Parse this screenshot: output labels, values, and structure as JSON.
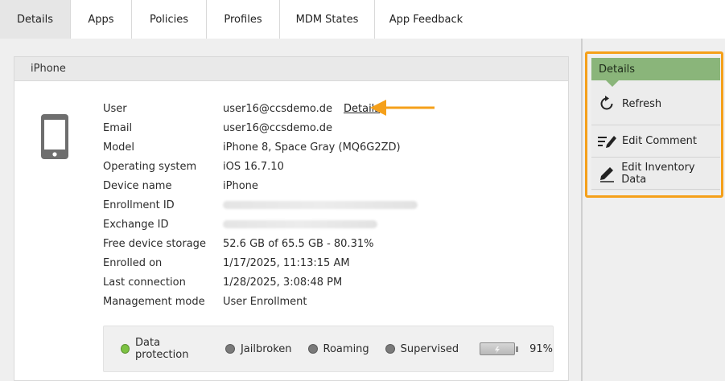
{
  "tabs": [
    {
      "label": "Details",
      "active": true
    },
    {
      "label": "Apps"
    },
    {
      "label": "Policies"
    },
    {
      "label": "Profiles"
    },
    {
      "label": "MDM States"
    },
    {
      "label": "App Feedback"
    }
  ],
  "device_panel": {
    "title": "iPhone",
    "rows": {
      "user": {
        "label": "User",
        "value": "user16@ccsdemo.de",
        "link": "Details"
      },
      "email": {
        "label": "Email",
        "value": "user16@ccsdemo.de"
      },
      "model": {
        "label": "Model",
        "value": "iPhone 8, Space Gray (MQ6G2ZD)"
      },
      "os": {
        "label": "Operating system",
        "value": "iOS 16.7.10"
      },
      "device_name": {
        "label": "Device name",
        "value": "iPhone"
      },
      "enrollment_id": {
        "label": "Enrollment ID",
        "value": ""
      },
      "exchange_id": {
        "label": "Exchange ID",
        "value": ""
      },
      "storage": {
        "label": "Free device storage",
        "value": "52.6 GB of 65.5 GB - 80.31%"
      },
      "enrolled_on": {
        "label": "Enrolled on",
        "value": "1/17/2025, 11:13:15 AM"
      },
      "last_connection": {
        "label": "Last connection",
        "value": "1/28/2025, 3:08:48 PM"
      },
      "management_mode": {
        "label": "Management mode",
        "value": "User Enrollment"
      }
    },
    "status": {
      "data_protection": {
        "label": "Data protection",
        "color": "#7cc242"
      },
      "jailbroken": {
        "label": "Jailbroken",
        "color": "#7a7a7a"
      },
      "roaming": {
        "label": "Roaming",
        "color": "#7a7a7a"
      },
      "supervised": {
        "label": "Supervised",
        "color": "#7a7a7a"
      },
      "battery": {
        "percent_label": "91%",
        "level": 0.91
      }
    }
  },
  "sidebar": {
    "header": "Details",
    "actions": {
      "refresh": {
        "label": "Refresh",
        "icon": "refresh-icon"
      },
      "edit_comment": {
        "label": "Edit Comment",
        "icon": "edit-comment-icon"
      },
      "edit_inventory": {
        "label": "Edit Inventory Data",
        "icon": "pencil-icon"
      }
    }
  },
  "colors": {
    "accent_orange": "#f5a01a",
    "sidebar_header_green": "#8ab57a",
    "status_green": "#7cc242",
    "status_gray": "#7a7a7a"
  }
}
